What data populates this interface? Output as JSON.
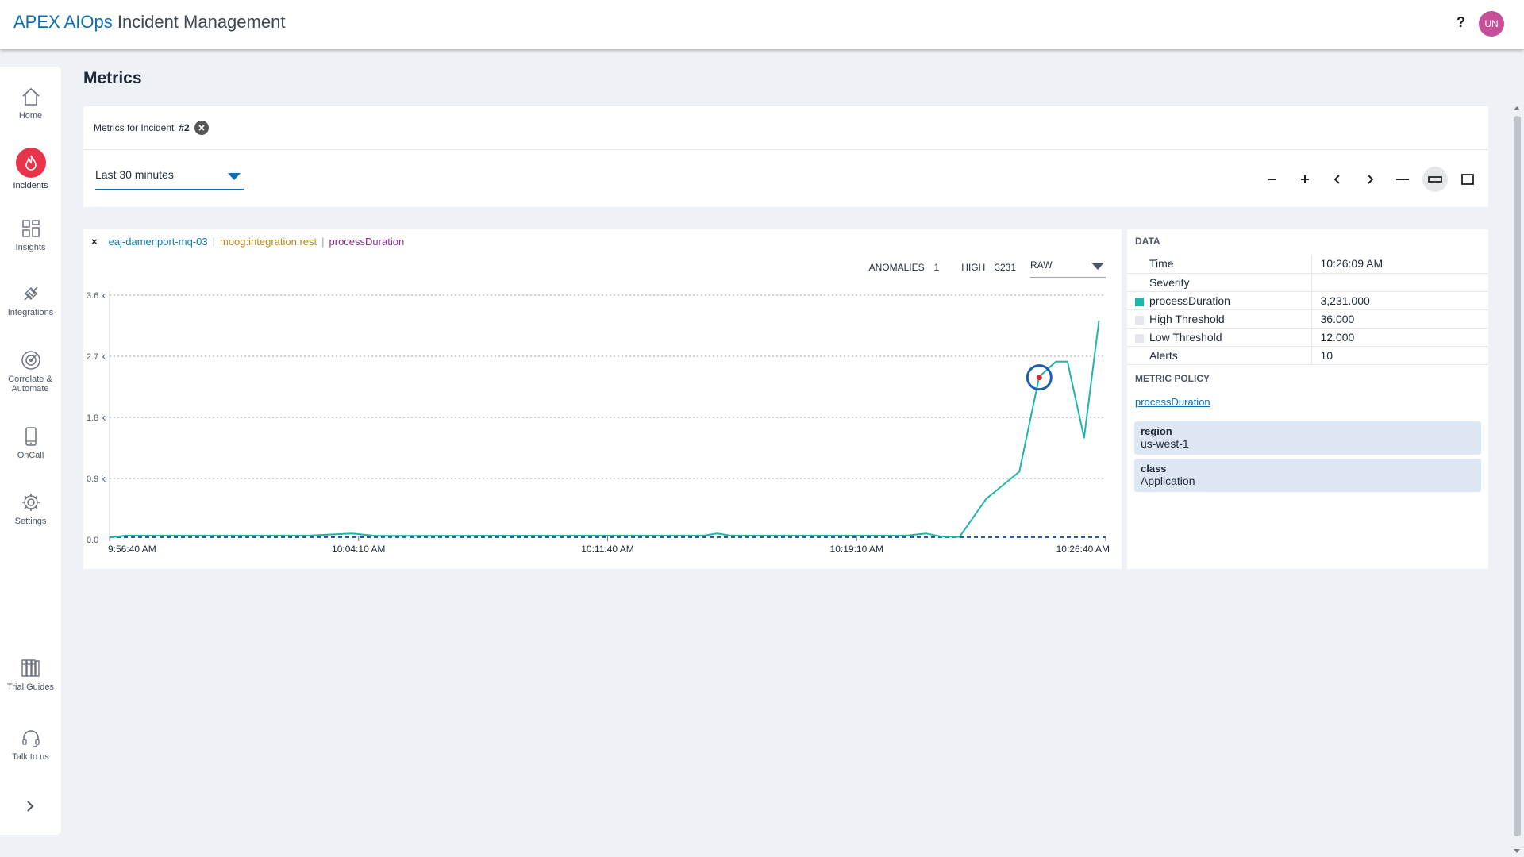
{
  "app": {
    "brand_primary": "APEX AIOps",
    "brand_secondary": "Incident Management",
    "help_label": "?",
    "user_initials": "UN"
  },
  "sidebar": {
    "items": [
      {
        "label": "Home",
        "icon": "home-icon"
      },
      {
        "label": "Incidents",
        "icon": "flame-icon"
      },
      {
        "label": "Insights",
        "icon": "dashboard-icon"
      },
      {
        "label": "Integrations",
        "icon": "plug-icon"
      },
      {
        "label": "Correlate & Automate",
        "icon": "target-icon"
      },
      {
        "label": "OnCall",
        "icon": "phone-icon"
      },
      {
        "label": "Settings",
        "icon": "gear-icon"
      },
      {
        "label": "Trial Guides",
        "icon": "books-icon"
      },
      {
        "label": "Talk to us",
        "icon": "headset-icon"
      }
    ],
    "active": "Incidents"
  },
  "page": {
    "title": "Metrics",
    "incident_prefix": "Metrics for Incident",
    "incident_number": "#2",
    "time_range": "Last 30 minutes"
  },
  "metric": {
    "source": "eaj-damenport-mq-03",
    "integration": "moog:integration:rest",
    "name": "processDuration",
    "anomalies_label": "ANOMALIES",
    "anomalies_value": "1",
    "high_label": "HIGH",
    "high_value": "3231",
    "mode": "RAW"
  },
  "data_panel": {
    "title": "DATA",
    "rows": [
      {
        "name": "Time",
        "value": "10:26:09 AM",
        "swatch": ""
      },
      {
        "name": "Severity",
        "value": "",
        "swatch": ""
      },
      {
        "name": "processDuration",
        "value": "3,231.000",
        "swatch": "#1fb5a8"
      },
      {
        "name": "High Threshold",
        "value": "36.000",
        "swatch": "#e5e7ec"
      },
      {
        "name": "Low Threshold",
        "value": "12.000",
        "swatch": "#e5e7ec"
      },
      {
        "name": "Alerts",
        "value": "10",
        "swatch": ""
      }
    ],
    "policy_title": "METRIC POLICY",
    "policy_link": "processDuration",
    "tags": [
      {
        "key": "region",
        "value": "us-west-1"
      },
      {
        "key": "class",
        "value": "Application"
      }
    ]
  },
  "colors": {
    "accent": "#0a6fb5",
    "incident_red": "#e8344a",
    "series": "#1fb5a8",
    "anomaly_ring": "#1a5fb4",
    "anomaly_dot": "#d32f2f"
  },
  "chart_data": {
    "type": "line",
    "title": "",
    "xlabel": "",
    "ylabel": "",
    "y_tick_labels": [
      "0.0",
      "0.9 k",
      "1.8 k",
      "2.7 k",
      "3.6 k"
    ],
    "y_tick_values": [
      0,
      900,
      1800,
      2700,
      3600
    ],
    "ylim": [
      0,
      3600
    ],
    "x_tick_labels": [
      "9:56:40 AM",
      "10:04:10 AM",
      "10:11:40 AM",
      "10:19:10 AM",
      "10:26:40 AM"
    ],
    "x_tick_minutes": [
      0,
      7.5,
      15,
      22.5,
      30
    ],
    "xlim_minutes": [
      0,
      30
    ],
    "grid": true,
    "series": [
      {
        "name": "processDuration",
        "x_minutes": [
          0,
          0.5,
          6,
          7.3,
          8,
          14,
          17.9,
          18.3,
          18.7,
          24,
          24.6,
          25,
          25.6,
          26.4,
          27.4,
          28,
          28.5,
          28.85,
          29.35,
          29.8
        ],
        "values": [
          30,
          60,
          60,
          90,
          55,
          60,
          60,
          90,
          60,
          60,
          90,
          50,
          40,
          600,
          1000,
          2400,
          2620,
          2620,
          1500,
          3231
        ]
      }
    ],
    "anomalies": [
      {
        "x_minutes": 28.0,
        "value": 2400
      }
    ],
    "threshold_lines": [
      {
        "name": "High Threshold",
        "value": 36
      },
      {
        "name": "Low Threshold",
        "value": 12
      }
    ]
  }
}
